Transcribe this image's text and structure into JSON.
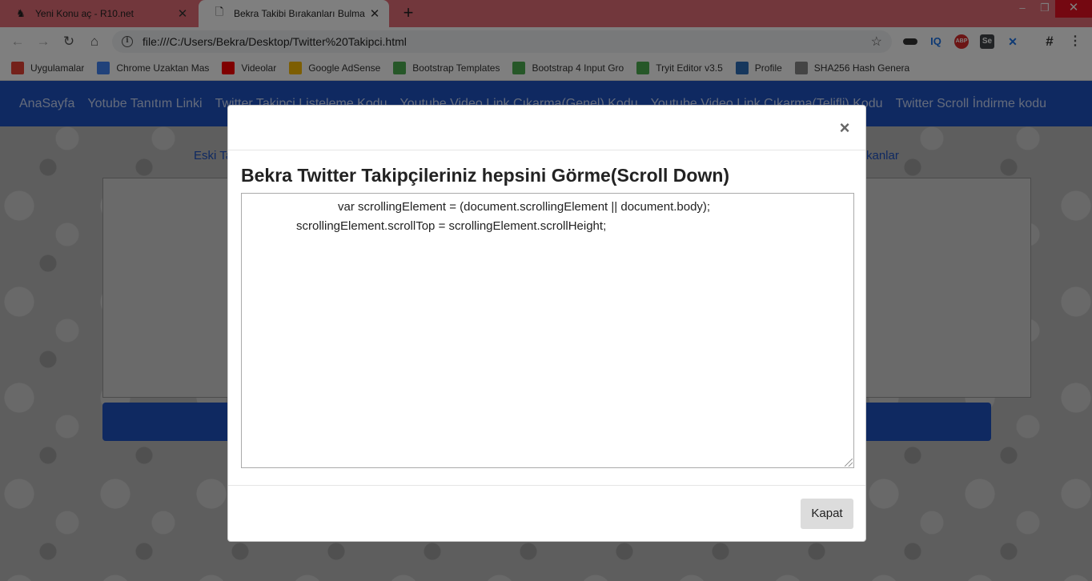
{
  "browser": {
    "tabs": [
      {
        "title": "Yeni Konu aç - R10.net",
        "icon": "r10-favicon",
        "active": false
      },
      {
        "title": "Bekra Takibi Bırakanları Bulma",
        "icon": "page-icon",
        "active": true
      }
    ],
    "address": "file:///C:/Users/Bekra/Desktop/Twitter%20Takipci.html",
    "bookmarks": [
      {
        "label": "Uygulamalar",
        "icon": "apps-grid-icon",
        "color": "#e94235"
      },
      {
        "label": "Chrome Uzaktan Mas",
        "icon": "chrome-remote-icon",
        "color": "#4285f4"
      },
      {
        "label": "Videolar",
        "icon": "youtube-icon",
        "color": "#ff0000"
      },
      {
        "label": "Google AdSense",
        "icon": "adsense-icon",
        "color": "#fbbc04"
      },
      {
        "label": "Bootstrap Templates",
        "icon": "w3-icon",
        "color": "#4caf50"
      },
      {
        "label": "Bootstrap 4 Input Gro",
        "icon": "w3-icon",
        "color": "#4caf50"
      },
      {
        "label": "Tryit Editor v3.5",
        "icon": "w3-icon",
        "color": "#4caf50"
      },
      {
        "label": "Profile",
        "icon": "profile-icon",
        "color": "#2c6fbb"
      },
      {
        "label": "SHA256 Hash Genera",
        "icon": "page-icon",
        "color": "#888888"
      }
    ],
    "extensions": {
      "iq": "IQ",
      "abp": "ABP",
      "se": "Se"
    }
  },
  "site": {
    "nav": [
      "AnaSayfa",
      "Yotube Tanıtım Linki",
      "Twitter Takipçi Listeleme Kodu",
      "Youtube Video Link Çıkarma(Genel) Kodu",
      "Youtube Video Link Çıkarma(Telifli) Kodu",
      "Twitter Scroll İndirme kodu"
    ],
    "sublink_left": "Eski Ta",
    "sublink_right": "kanlar",
    "accent": "#1f53c3"
  },
  "modal": {
    "title": "Bekra Twitter Takipçileriniz hepsini Görme(Scroll Down)",
    "code_lines": [
      "var scrollingElement = (document.scrollingElement || document.body);",
      "scrollingElement.scrollTop = scrollingElement.scrollHeight;"
    ],
    "close_symbol": "×",
    "button_label": "Kapat"
  }
}
